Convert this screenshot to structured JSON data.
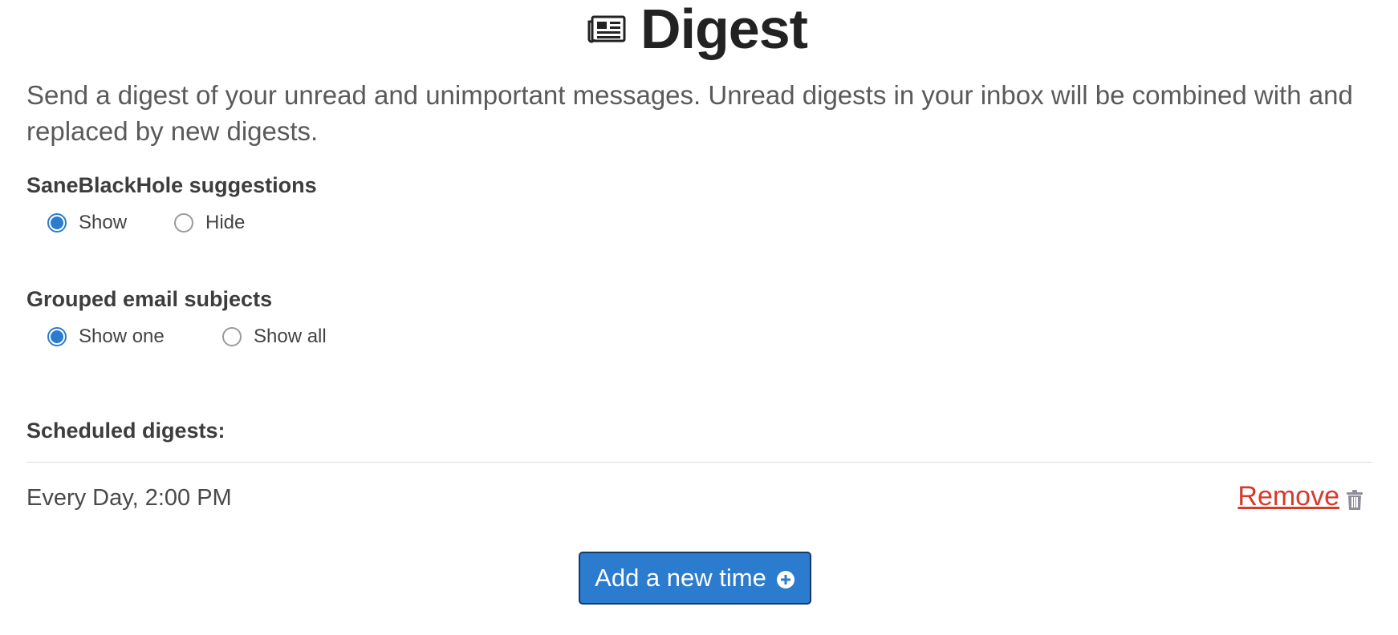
{
  "header": {
    "title": "Digest",
    "icon": "newspaper-icon"
  },
  "description": "Send a digest of your unread and unimportant messages. Unread digests in your inbox will be combined with and replaced by new digests.",
  "suggestions": {
    "label": "SaneBlackHole suggestions",
    "options": [
      {
        "label": "Show",
        "checked": true
      },
      {
        "label": "Hide",
        "checked": false
      }
    ]
  },
  "grouped": {
    "label": "Grouped email subjects",
    "options": [
      {
        "label": "Show one",
        "checked": true
      },
      {
        "label": "Show all",
        "checked": false
      }
    ]
  },
  "scheduled": {
    "label": "Scheduled digests:",
    "items": [
      {
        "time": "Every Day, 2:00 PM",
        "remove_label": "Remove",
        "remove_icon": "trash-icon"
      }
    ]
  },
  "add_button": {
    "label": "Add a new time",
    "icon": "plus-circle-icon"
  },
  "colors": {
    "accent": "#2b7bcf",
    "danger": "#d63a2a",
    "button_border": "#143a66"
  }
}
